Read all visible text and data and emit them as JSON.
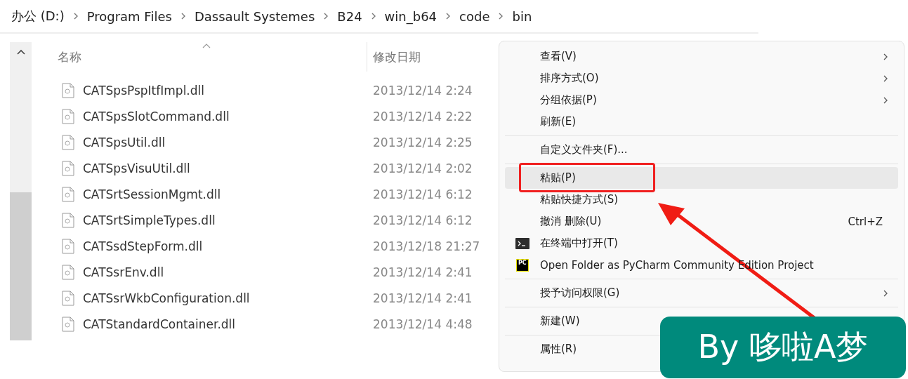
{
  "breadcrumb": [
    "办公 (D:)",
    "Program Files",
    "Dassault Systemes",
    "B24",
    "win_b64",
    "code",
    "bin"
  ],
  "columns": [
    {
      "label": "名称",
      "sorted": true
    },
    {
      "label": "修改日期",
      "sorted": false
    }
  ],
  "files": [
    {
      "name": "CATSpsPspItfImpl.dll",
      "modified": "2013/12/14 2:24"
    },
    {
      "name": "CATSpsSlotCommand.dll",
      "modified": "2013/12/14 2:22"
    },
    {
      "name": "CATSpsUtil.dll",
      "modified": "2013/12/14 2:25"
    },
    {
      "name": "CATSpsVisuUtil.dll",
      "modified": "2013/12/14 2:02"
    },
    {
      "name": "CATSrtSessionMgmt.dll",
      "modified": "2013/12/14 6:12"
    },
    {
      "name": "CATSrtSimpleTypes.dll",
      "modified": "2013/12/14 6:12"
    },
    {
      "name": "CATSsdStepForm.dll",
      "modified": "2013/12/18 21:27"
    },
    {
      "name": "CATSsrEnv.dll",
      "modified": "2013/12/14 2:41"
    },
    {
      "name": "CATSsrWkbConfiguration.dll",
      "modified": "2013/12/14 2:41"
    },
    {
      "name": "CATStandardContainer.dll",
      "modified": "2013/12/14 4:48"
    }
  ],
  "context_menu": [
    {
      "kind": "item",
      "label": "查看(V)",
      "submenu": true,
      "selected": false,
      "boxed": false
    },
    {
      "kind": "item",
      "label": "排序方式(O)",
      "submenu": true,
      "selected": false,
      "boxed": false
    },
    {
      "kind": "item",
      "label": "分组依据(P)",
      "submenu": true,
      "selected": false,
      "boxed": false
    },
    {
      "kind": "item",
      "label": "刷新(E)",
      "submenu": false,
      "selected": false,
      "boxed": false
    },
    {
      "kind": "separator"
    },
    {
      "kind": "item",
      "label": "自定义文件夹(F)...",
      "submenu": false,
      "selected": false,
      "boxed": false
    },
    {
      "kind": "separator"
    },
    {
      "kind": "item",
      "label": "粘贴(P)",
      "submenu": false,
      "selected": true,
      "boxed": true
    },
    {
      "kind": "item",
      "label": "粘贴快捷方式(S)",
      "submenu": false,
      "selected": false,
      "boxed": false
    },
    {
      "kind": "item",
      "label": "撤消 删除(U)",
      "submenu": false,
      "selected": false,
      "boxed": false,
      "shortcut": "Ctrl+Z"
    },
    {
      "kind": "terminal",
      "label": "在终端中打开(T)",
      "submenu": false,
      "selected": false,
      "boxed": false
    },
    {
      "kind": "app",
      "label": "Open Folder as PyCharm Community Edition Project",
      "submenu": false,
      "selected": false,
      "boxed": false,
      "icon_label": "PC"
    },
    {
      "kind": "separator"
    },
    {
      "kind": "item",
      "label": "授予访问权限(G)",
      "submenu": true,
      "selected": false,
      "boxed": false
    },
    {
      "kind": "separator"
    },
    {
      "kind": "item",
      "label": "新建(W)",
      "submenu": false,
      "selected": false,
      "boxed": false
    },
    {
      "kind": "separator"
    },
    {
      "kind": "item",
      "label": "属性(R)",
      "submenu": false,
      "selected": false,
      "boxed": false
    }
  ],
  "overlay_label": "By 哆啦A梦"
}
